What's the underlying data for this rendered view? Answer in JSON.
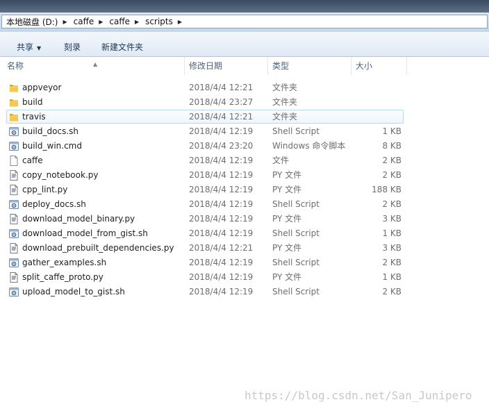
{
  "address": {
    "crumbs": [
      "本地磁盘 (D:)",
      "caffe",
      "caffe",
      "scripts"
    ]
  },
  "toolbar": {
    "share_label": "共享",
    "burn_label": "刻录",
    "new_folder_label": "新建文件夹"
  },
  "columns": {
    "name": "名称",
    "date": "修改日期",
    "type": "类型",
    "size": "大小"
  },
  "files": [
    {
      "name": "appveyor",
      "date": "2018/4/4 12:21",
      "type": "文件夹",
      "size": "",
      "icon": "folder-icon"
    },
    {
      "name": "build",
      "date": "2018/4/4 23:27",
      "type": "文件夹",
      "size": "",
      "icon": "folder-icon"
    },
    {
      "name": "travis",
      "date": "2018/4/4 12:21",
      "type": "文件夹",
      "size": "",
      "icon": "folder-icon",
      "selected": true
    },
    {
      "name": "build_docs.sh",
      "date": "2018/4/4 12:19",
      "type": "Shell Script",
      "size": "1 KB",
      "icon": "script-icon"
    },
    {
      "name": "build_win.cmd",
      "date": "2018/4/4 23:20",
      "type": "Windows 命令脚本",
      "size": "8 KB",
      "icon": "script-icon"
    },
    {
      "name": "caffe",
      "date": "2018/4/4 12:19",
      "type": "文件",
      "size": "2 KB",
      "icon": "blank-file-icon"
    },
    {
      "name": "copy_notebook.py",
      "date": "2018/4/4 12:19",
      "type": "PY 文件",
      "size": "2 KB",
      "icon": "py-file-icon"
    },
    {
      "name": "cpp_lint.py",
      "date": "2018/4/4 12:19",
      "type": "PY 文件",
      "size": "188 KB",
      "icon": "py-file-icon"
    },
    {
      "name": "deploy_docs.sh",
      "date": "2018/4/4 12:19",
      "type": "Shell Script",
      "size": "2 KB",
      "icon": "script-icon"
    },
    {
      "name": "download_model_binary.py",
      "date": "2018/4/4 12:19",
      "type": "PY 文件",
      "size": "3 KB",
      "icon": "py-file-icon"
    },
    {
      "name": "download_model_from_gist.sh",
      "date": "2018/4/4 12:19",
      "type": "Shell Script",
      "size": "1 KB",
      "icon": "script-icon"
    },
    {
      "name": "download_prebuilt_dependencies.py",
      "date": "2018/4/4 12:21",
      "type": "PY 文件",
      "size": "3 KB",
      "icon": "py-file-icon"
    },
    {
      "name": "gather_examples.sh",
      "date": "2018/4/4 12:19",
      "type": "Shell Script",
      "size": "2 KB",
      "icon": "script-icon"
    },
    {
      "name": "split_caffe_proto.py",
      "date": "2018/4/4 12:19",
      "type": "PY 文件",
      "size": "1 KB",
      "icon": "py-file-icon"
    },
    {
      "name": "upload_model_to_gist.sh",
      "date": "2018/4/4 12:19",
      "type": "Shell Script",
      "size": "2 KB",
      "icon": "script-icon"
    }
  ],
  "watermark": "https://blog.csdn.net/San_Junipero",
  "colors": {
    "folder": "#e8b936",
    "selection_border": "#b9d7f0",
    "toolbar_text": "#1c3553"
  }
}
